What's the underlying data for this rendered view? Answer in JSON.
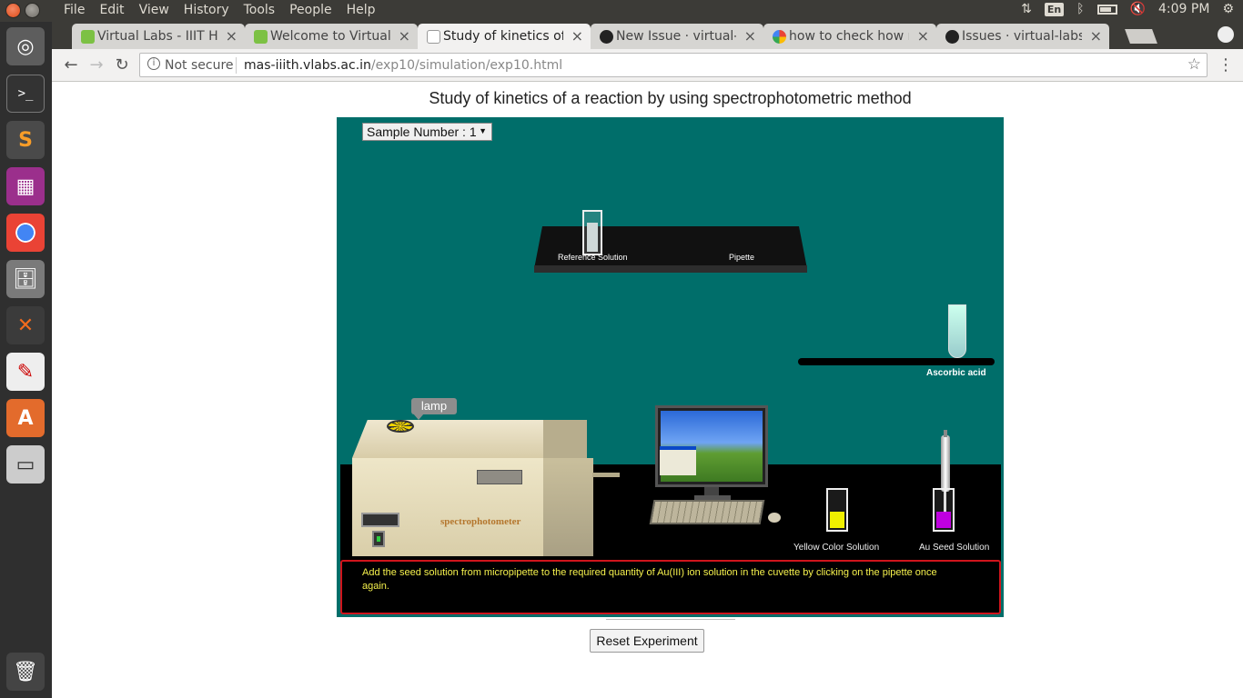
{
  "system_menu": {
    "items": [
      "File",
      "Edit",
      "View",
      "History",
      "Tools",
      "People",
      "Help"
    ],
    "keyboard_layout": "En",
    "clock": "4:09 PM"
  },
  "tabs": [
    {
      "label": "Virtual Labs - IIIT Hy",
      "icon": "vlabs-favicon"
    },
    {
      "label": "Welcome to Virtual",
      "icon": "vlabs-favicon"
    },
    {
      "label": "Study of kinetics of",
      "icon": "page-favicon"
    },
    {
      "label": "New Issue · virtual-l",
      "icon": "github-favicon"
    },
    {
      "label": "how to check how n",
      "icon": "google-favicon"
    },
    {
      "label": "Issues · virtual-labs/",
      "icon": "github-favicon"
    }
  ],
  "address_bar": {
    "security": "Not secure",
    "host": "mas-iiith.vlabs.ac.in",
    "path": "/exp10/simulation/exp10.html"
  },
  "page": {
    "title": "Study of kinetics of a reaction by using spectrophotometric method",
    "sample_select": "Sample Number : 1",
    "shelf_labels": {
      "reference": "Reference Solution",
      "pipette": "Pipette"
    },
    "ascorbic_label": "Ascorbic acid",
    "lamp_label": "lamp",
    "spectro_label": "spectrophotometer",
    "yellow_label": "Yellow Color Solution",
    "seed_label": "Au Seed Solution",
    "instruction": "Add the seed solution from micropipette to the required quantity of Au(III) ion solution in the cuvette by clicking on the pipette once again.",
    "reset_button": "Reset Experiment"
  },
  "colors": {
    "sim_background": "#006e6a",
    "instruction_text": "#f6f24d",
    "instruction_border": "#d0141c",
    "yellow_solution": "#f0f000",
    "seed_solution": "#c000e0"
  }
}
